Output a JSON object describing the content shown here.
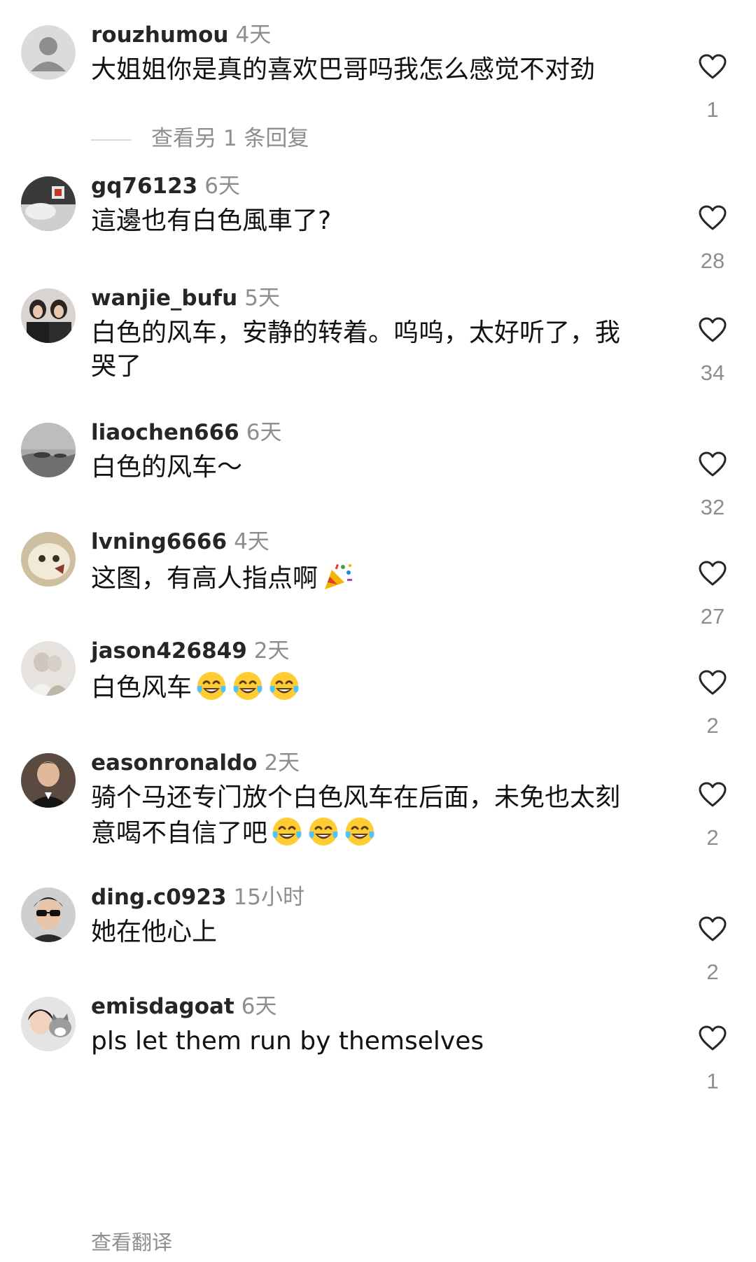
{
  "comments": [
    {
      "username": "rouzhumou",
      "time": "4天",
      "text": "大姐姐你是真的喜欢巴哥吗我怎么感觉不对劲",
      "likes": "1"
    },
    {
      "username": "gq76123",
      "time": "6天",
      "text": "這邊也有白色風車了?",
      "likes": "28"
    },
    {
      "username": "wanjie_bufu",
      "time": "5天",
      "text": "白色的风车，安静的转着。呜呜，太好听了，我哭了",
      "likes": "34"
    },
    {
      "username": "liaochen666",
      "time": "6天",
      "text": "白色的风车～",
      "likes": "32"
    },
    {
      "username": "lvning6666",
      "time": "4天",
      "text": "这图，有高人指点啊",
      "likes": "27",
      "emoji": "party-popper"
    },
    {
      "username": "jason426849",
      "time": "2天",
      "text": "白色风车",
      "likes": "2",
      "emoji": "tears-of-joy x3"
    },
    {
      "username": "easonronaldo",
      "time": "2天",
      "text": "骑个马还专门放个白色风车在后面，未免也太刻意喝不自信了吧",
      "likes": "2",
      "emoji": "tears-of-joy x3"
    },
    {
      "username": "ding.c0923",
      "time": "15小时",
      "text": "她在他心上",
      "likes": "2"
    },
    {
      "username": "emisdagoat",
      "time": "6天",
      "text": "pls let them run by themselves",
      "likes": "1"
    }
  ],
  "view_replies_label": "查看另 1 条回复",
  "translate_label": "查看翻译",
  "colors": {
    "secondary_text": "#8e8e8e",
    "primary_text": "#111111",
    "username": "#262626"
  }
}
